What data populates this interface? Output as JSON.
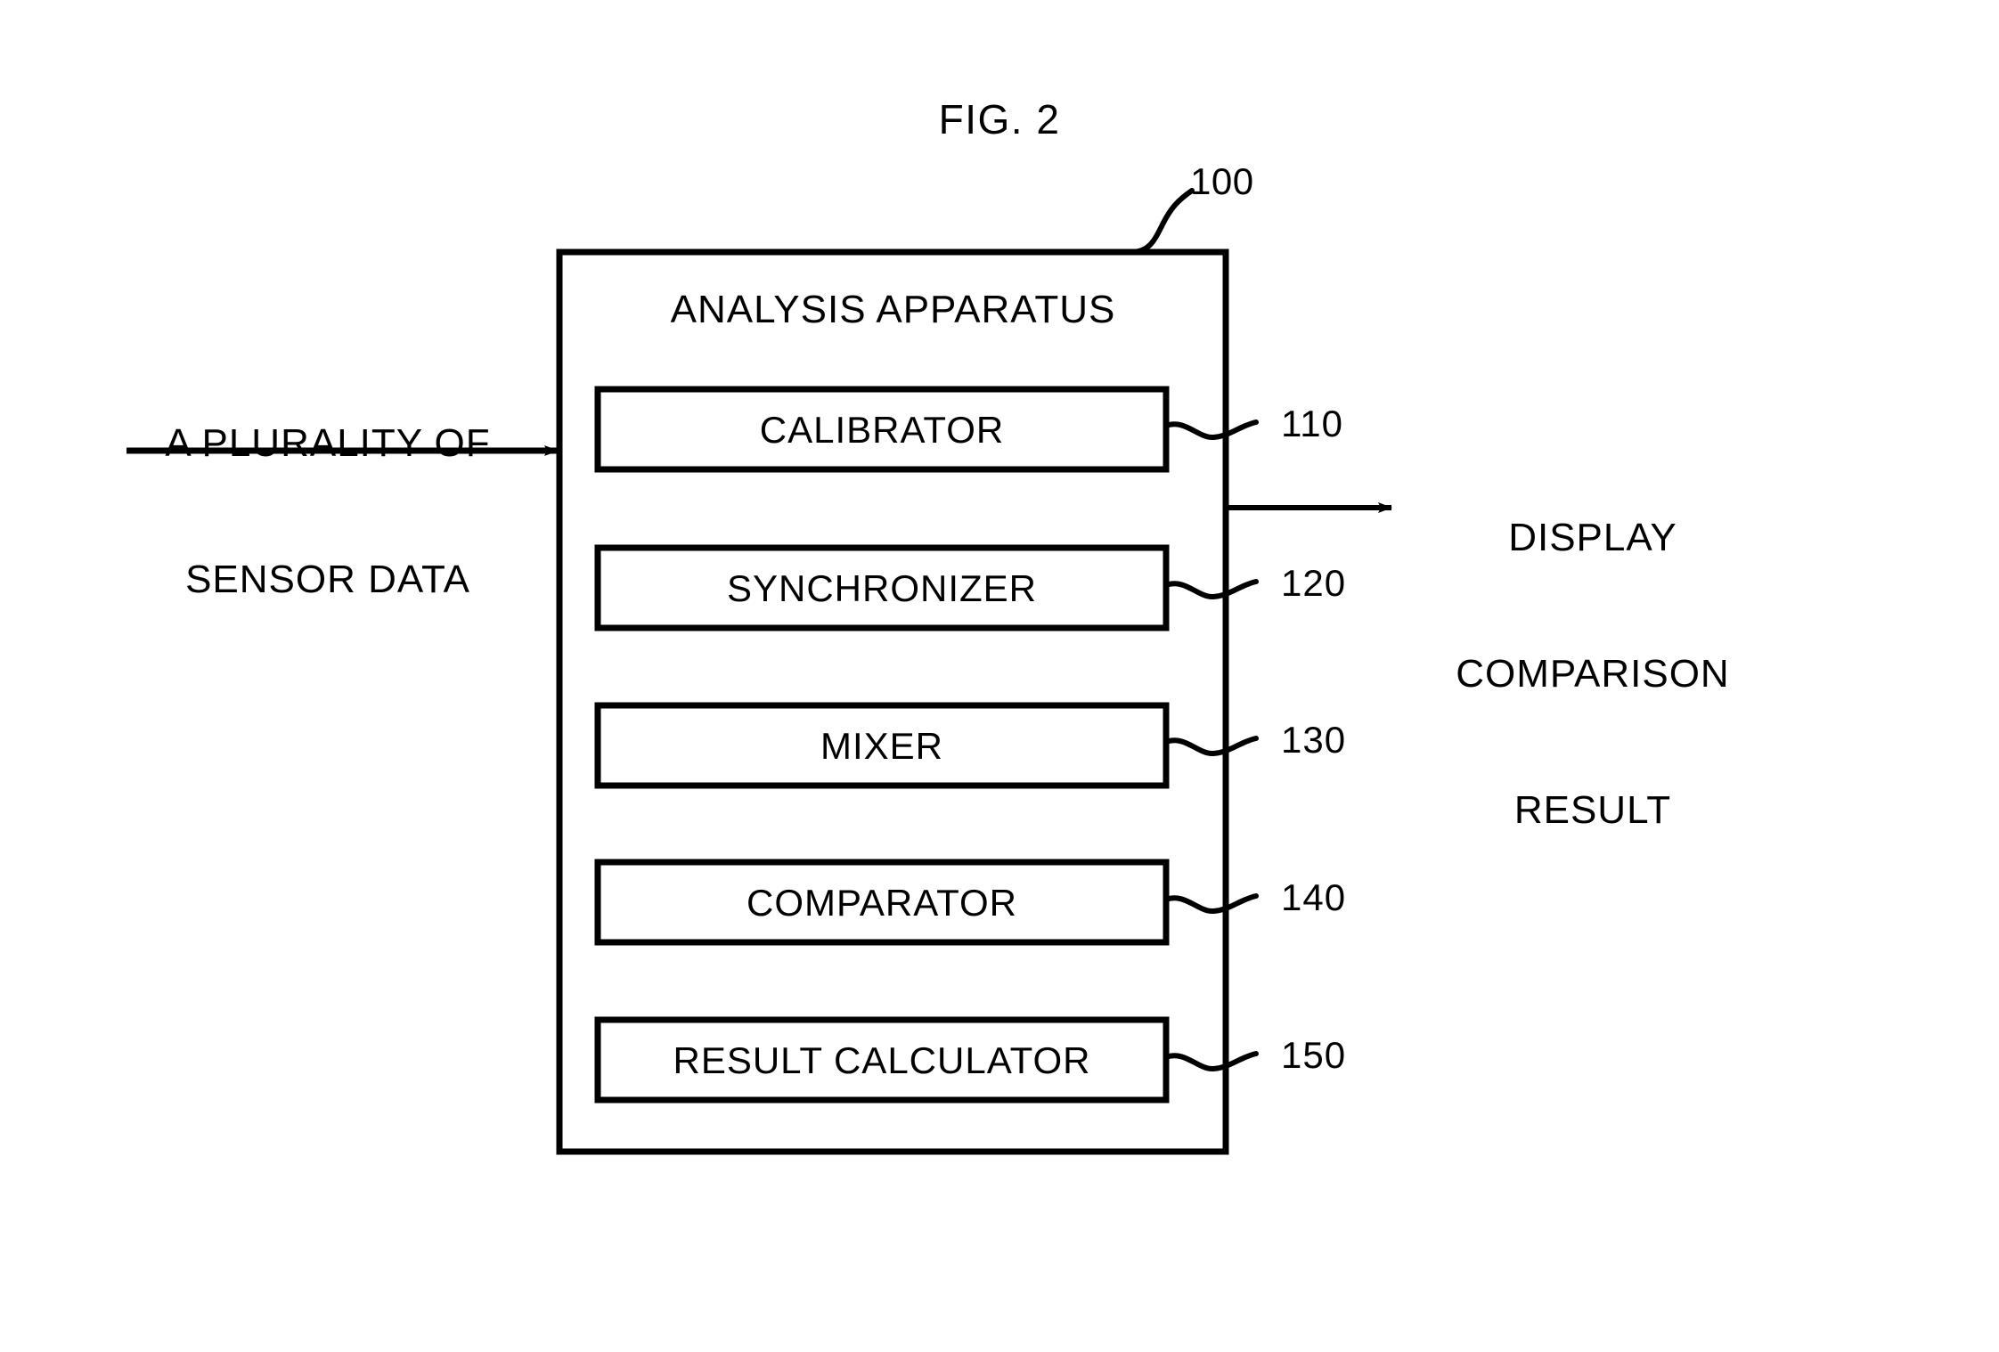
{
  "figure": {
    "title": "FIG. 2",
    "reference_numeral": "100"
  },
  "apparatus": {
    "title": "ANALYSIS APPARATUS",
    "modules": [
      {
        "label": "CALIBRATOR",
        "ref": "110"
      },
      {
        "label": "SYNCHRONIZER",
        "ref": "120"
      },
      {
        "label": "MIXER",
        "ref": "130"
      },
      {
        "label": "COMPARATOR",
        "ref": "140"
      },
      {
        "label": "RESULT CALCULATOR",
        "ref": "150"
      }
    ]
  },
  "input": {
    "line1": "A PLURALITY OF",
    "line2": "SENSOR DATA"
  },
  "output": {
    "line1": "DISPLAY",
    "line2": "COMPARISON",
    "line3": "RESULT"
  },
  "colors": {
    "ink": "#000000",
    "background": "#ffffff"
  }
}
